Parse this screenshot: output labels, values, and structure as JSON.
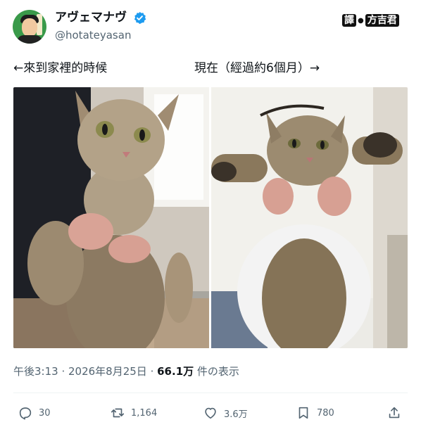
{
  "author": {
    "display_name": "アヴェマナヴ",
    "handle": "@hotateyasan",
    "verified_icon": "verified-badge-icon",
    "verified_color": "#1d9bf0"
  },
  "watermark": {
    "left": "譯",
    "right": "方吉君"
  },
  "captions": {
    "left": "←來到家裡的時候",
    "right": "現在（經過約6個月）→"
  },
  "photos": [
    {
      "name": "cat-photo-then"
    },
    {
      "name": "cat-photo-now"
    }
  ],
  "meta": {
    "time": "午後3:13",
    "separator1": " · ",
    "date": "2026年8月25日",
    "separator2": " · ",
    "views_count": "66.1万",
    "views_label": " 件の表示"
  },
  "actions": {
    "reply_count": "30",
    "retweet_count": "1,164",
    "like_count": "3.6万",
    "bookmark_count": "780"
  },
  "colors": {
    "text_primary": "#0f1419",
    "text_secondary": "#536471",
    "avatar_bg": "#3a9a4a"
  }
}
